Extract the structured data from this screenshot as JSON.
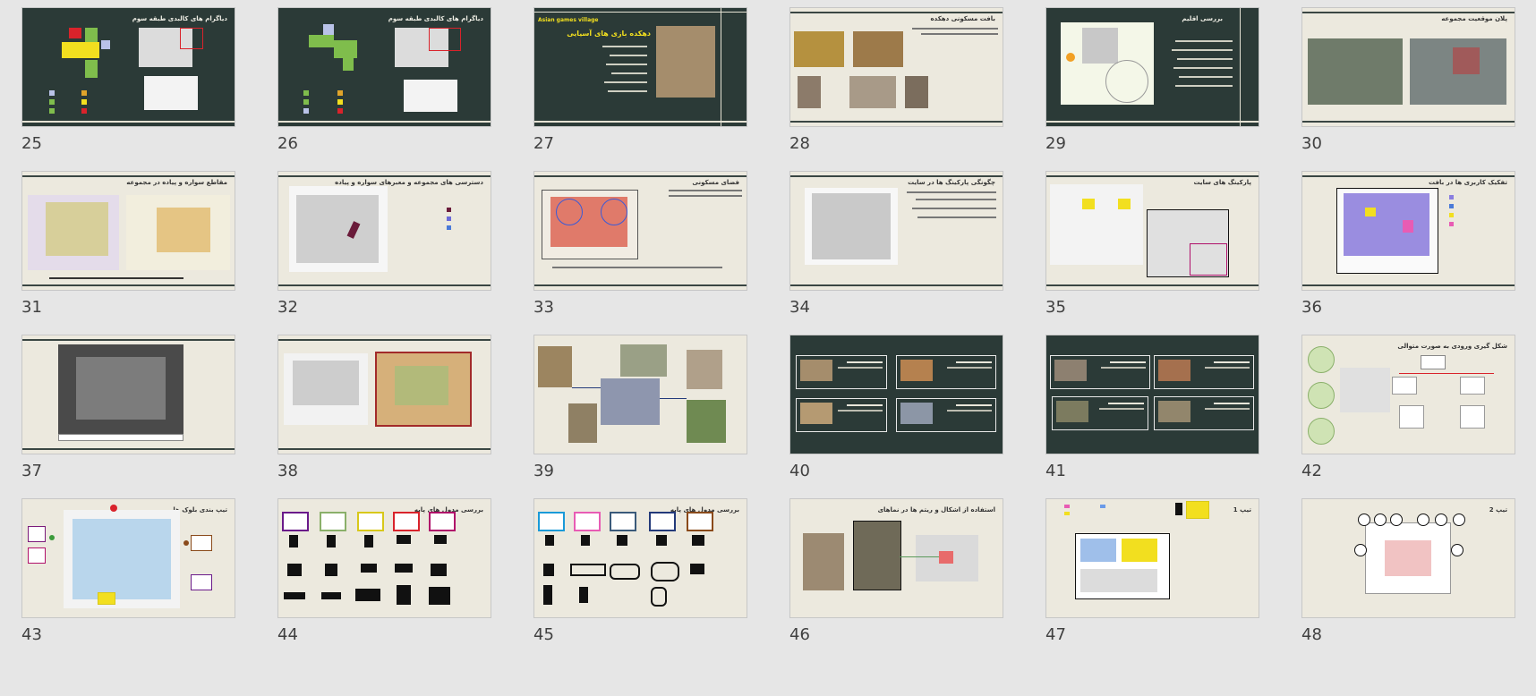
{
  "slides": [
    {
      "number": "25",
      "title": "دیاگرام های کالبدی طبقه سوم",
      "theme": "dark"
    },
    {
      "number": "26",
      "title": "دیاگرام های کالبدی طبقه سوم",
      "theme": "dark"
    },
    {
      "number": "27",
      "title": "دهکده بازی های آسیایی",
      "subtitle": "Asian games village",
      "theme": "dark"
    },
    {
      "number": "28",
      "title": "بافت مسکونی دهکده",
      "theme": "light"
    },
    {
      "number": "29",
      "title": "بررسی اقلیم",
      "theme": "dark"
    },
    {
      "number": "30",
      "title": "پلان موقعیت مجموعه",
      "theme": "light"
    },
    {
      "number": "31",
      "title": "مقاطع سواره و پیاده در مجموعه",
      "theme": "light"
    },
    {
      "number": "32",
      "title": "دسترسی های مجموعه و معبرهای سواره و پیاده",
      "theme": "light"
    },
    {
      "number": "33",
      "title": "فضای مسکونی",
      "theme": "light"
    },
    {
      "number": "34",
      "title": "چگونگی پارکینگ ها در سایت",
      "theme": "light"
    },
    {
      "number": "35",
      "title": "پارکینگ های سایت",
      "theme": "light"
    },
    {
      "number": "36",
      "title": "تفکیک کاربری ها در بافت",
      "theme": "light"
    },
    {
      "number": "37",
      "title": "",
      "theme": "light"
    },
    {
      "number": "38",
      "title": "",
      "theme": "light"
    },
    {
      "number": "39",
      "title": "",
      "theme": "light"
    },
    {
      "number": "40",
      "title": "",
      "theme": "dark"
    },
    {
      "number": "41",
      "title": "",
      "theme": "dark"
    },
    {
      "number": "42",
      "title": "شکل گیری ورودی به صورت متوالی",
      "theme": "light"
    },
    {
      "number": "43",
      "title": "تیپ بندی بلوک ها",
      "theme": "light"
    },
    {
      "number": "44",
      "title": "بررسی مدول های پایه",
      "theme": "light"
    },
    {
      "number": "45",
      "title": "بررسی مدول های پایه",
      "theme": "light"
    },
    {
      "number": "46",
      "title": "استفاده از اشکال و ریتم ها در نماهای",
      "theme": "light"
    },
    {
      "number": "47",
      "title": "تیپ 1",
      "theme": "light"
    },
    {
      "number": "48",
      "title": "تیپ 2",
      "theme": "light"
    }
  ],
  "colors": {
    "background": "#e6e6e6",
    "dark_slide": "#2b3a37",
    "light_slide": "#ece9de",
    "accent_yellow": "#f2df1f",
    "accent_green": "#7fbd4c",
    "accent_red": "#d9232b"
  }
}
